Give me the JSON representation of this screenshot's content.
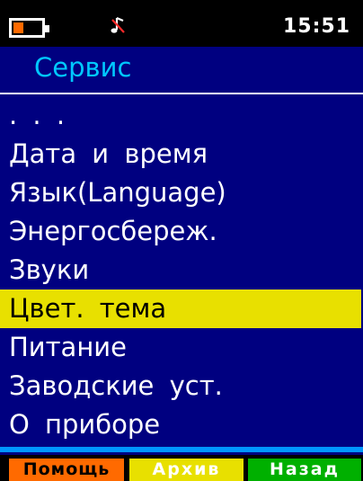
{
  "status_bar": {
    "time": "15:51",
    "battery_level": 0.35,
    "battery_icon": "battery-icon",
    "sound_icon": "sound-muted-icon"
  },
  "screen": {
    "title": "Сервис"
  },
  "menu": {
    "items": [
      {
        "label": ". . ."
      },
      {
        "label": "Дата и время"
      },
      {
        "label": "Язык(Language)"
      },
      {
        "label": "Энергосбереж."
      },
      {
        "label": "Звуки"
      },
      {
        "label": "Цвет. тема"
      },
      {
        "label": "Питание"
      },
      {
        "label": "Заводские уст."
      },
      {
        "label": "О приборе"
      }
    ],
    "selected_index": 5
  },
  "softkeys": {
    "help": "Помощь",
    "archive": "Архив",
    "back": "Назад"
  },
  "colors": {
    "background": "#000080",
    "title": "#00c8ff",
    "selection": "#e8e000",
    "help_key": "#ff6a00",
    "archive_key": "#e8e000",
    "back_key": "#00b000",
    "battery_fill": "#ff6a00"
  }
}
